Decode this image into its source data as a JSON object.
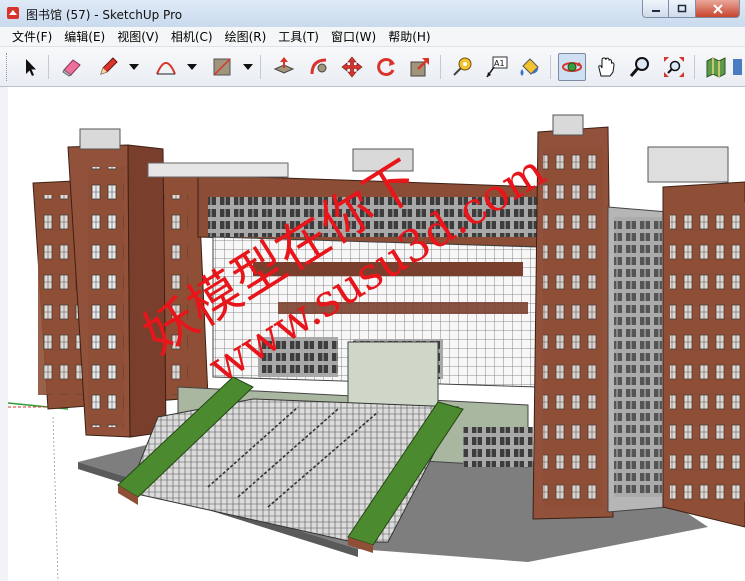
{
  "window": {
    "title": "图书馆 (57) - SketchUp Pro"
  },
  "menu": {
    "items": [
      {
        "name": "menu-file",
        "label": "文件(F)"
      },
      {
        "name": "menu-edit",
        "label": "编辑(E)"
      },
      {
        "name": "menu-view",
        "label": "视图(V)"
      },
      {
        "name": "menu-camera",
        "label": "相机(C)"
      },
      {
        "name": "menu-draw",
        "label": "绘图(R)"
      },
      {
        "name": "menu-tools",
        "label": "工具(T)"
      },
      {
        "name": "menu-window",
        "label": "窗口(W)"
      },
      {
        "name": "menu-help",
        "label": "帮助(H)"
      }
    ]
  },
  "toolbar": {
    "tools": [
      "select-icon",
      "eraser-icon",
      "pencil-icon",
      "arc-icon",
      "rectangle-icon",
      "push-pull-icon",
      "follow-me-icon",
      "move-icon",
      "rotate-icon",
      "scale-icon",
      "tape-measure-icon",
      "text-icon",
      "paint-bucket-icon",
      "orbit-icon",
      "pan-icon",
      "zoom-icon",
      "zoom-extents-icon",
      "warehouse-icon"
    ],
    "text_tool_label": "A1",
    "active_tool": "orbit-icon"
  },
  "watermark": {
    "line1": "妖模型在你下",
    "line2": "www.susu3d.com"
  },
  "colors": {
    "brick": "#8f4f36",
    "watermark": "#e8151a",
    "grass": "#4c8a2f"
  }
}
